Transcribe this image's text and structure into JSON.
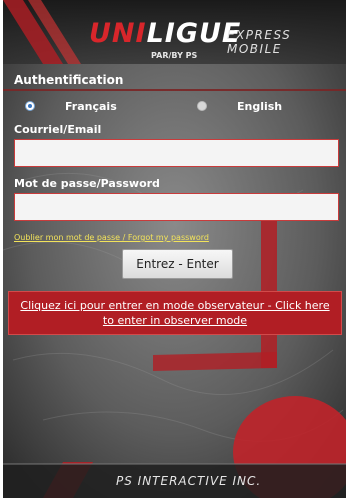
{
  "header": {
    "logo_main_a": "UNI",
    "logo_main_b": "LIGUE",
    "logo_sub": "PAR/BY PS",
    "logo_tag": "EXPRESS MOBILE"
  },
  "auth": {
    "title": "Authentification",
    "languages": [
      {
        "label": "Français",
        "selected": true
      },
      {
        "label": "English",
        "selected": false
      }
    ],
    "email_label": "Courriel/Email",
    "email_value": "",
    "password_label": "Mot de passe/Password",
    "password_value": "",
    "forgot_link": "Oublier mon mot de passe / Forgot my password",
    "enter_button": "Entrez - Enter"
  },
  "observer": {
    "text": "Cliquez ici pour entrer en mode observateur - Click here to enter in observer mode"
  },
  "footer": {
    "text": "PS INTERACTIVE INC."
  },
  "colors": {
    "accent_red": "#b11e24",
    "link_yellow": "#f2e35b",
    "field_border": "#c93b3b"
  }
}
